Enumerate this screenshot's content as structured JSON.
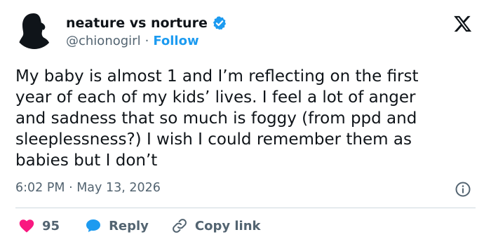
{
  "author": {
    "display_name": "neature vs norture",
    "handle": "@chionogirl",
    "separator": "·",
    "follow_label": "Follow"
  },
  "tweet": {
    "text": "My baby is almost 1 and I’m reflecting on the first\nyear of each of my kids’ lives. I feel a lot of anger\nand sadness that so much is foggy (from ppd and\nsleeplessness?) I wish I could remember them as\nbabies but I don’t",
    "timestamp": "6:02 PM · May 13, 2026"
  },
  "actions": {
    "like_count": "95",
    "reply_label": "Reply",
    "copy_link_label": "Copy link"
  },
  "icons": {
    "verified": "verified-badge-icon",
    "platform": "x-logo-icon",
    "info": "info-icon",
    "like": "heart-icon",
    "reply": "speech-bubble-icon",
    "copy": "link-icon"
  },
  "colors": {
    "accent_blue": "#1d9bf0",
    "like_red": "#f91880",
    "text": "#0f1419",
    "secondary": "#536471"
  }
}
